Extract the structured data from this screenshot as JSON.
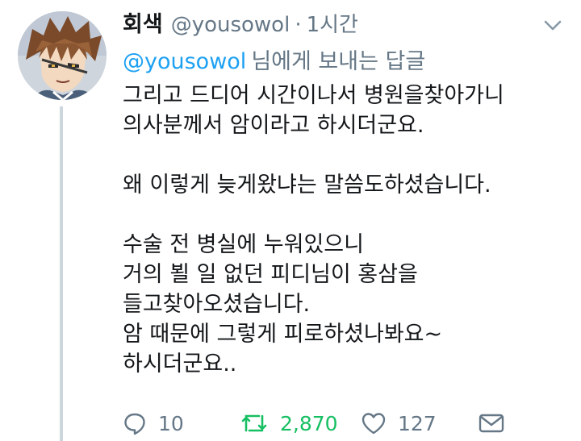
{
  "tweet": {
    "display_name": "회색",
    "handle": "@yousowol",
    "separator": "·",
    "time": "1시간",
    "reply_to_mention": "@yousowol",
    "reply_to_suffix": "님에게 보내는 답글",
    "paragraphs": [
      [
        "그리고 드디어 시간이나서 병원을찾아가니",
        "의사분께서 암이라고 하시더군요."
      ],
      [
        "왜 이렇게 늦게왔냐는 말씀도하셨습니다."
      ],
      [
        "수술 전 병실에 누워있으니",
        "거의 뵐 일 없던 피디님이 홍삼을",
        "들고찾아오셨습니다.",
        "암 때문에 그렇게 피로하셨나봐요~",
        "하시더군요.."
      ]
    ]
  },
  "actions": {
    "reply_count": "10",
    "retweet_count": "2,870",
    "like_count": "127"
  },
  "icons": {
    "reply": "reply-bubble-icon",
    "retweet": "retweet-icon",
    "like": "heart-icon",
    "message": "envelope-icon",
    "menu": "chevron-down-icon"
  },
  "colors": {
    "link_blue": "#1da1f2",
    "muted_gray": "#657786",
    "retweet_green": "#17bf63",
    "text": "#14171a",
    "thread_line": "#ccd6dd"
  }
}
